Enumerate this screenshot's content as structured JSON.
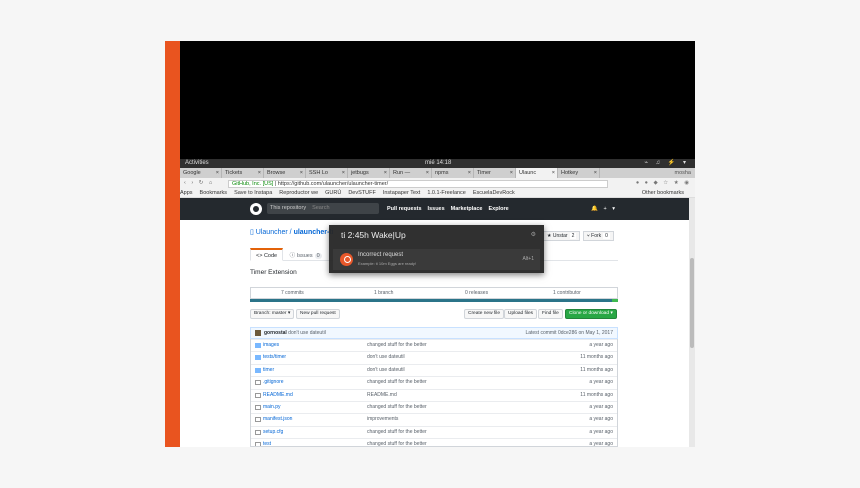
{
  "topbar": {
    "activities": "Activities",
    "clock": "mié 14:18",
    "tray": "⌁ ♫ ⚡ ▾"
  },
  "browser": {
    "tabs": [
      {
        "label": "Google",
        "active": false
      },
      {
        "label": "Tickets",
        "active": false
      },
      {
        "label": "Browse",
        "active": false
      },
      {
        "label": "SSH Lo",
        "active": false
      },
      {
        "label": "jetbugs",
        "active": false
      },
      {
        "label": "Run —",
        "active": false
      },
      {
        "label": "npms",
        "active": false
      },
      {
        "label": "Timer",
        "active": false
      },
      {
        "label": "Ulaunc",
        "active": true
      },
      {
        "label": "Hotkey",
        "active": false
      }
    ],
    "tab_close": "×",
    "window_user": "mosha",
    "nav_icons": "‹ › ↻ ⌂",
    "url_secure": "GitHub, Inc. [US]",
    "url": "https://github.com/ulauncher/ulauncher-timer/",
    "extension_icons": "● ● ◆ ☆ ★ ◉",
    "bookmarks": [
      "Apps",
      "Bookmarks",
      "Save to Instapa",
      "Reproductor we",
      "GURÚ",
      "DevSTUFF",
      "Instapaper Text",
      "1.0.1-Freelance",
      "EscuelaDevRock"
    ],
    "other_bookmarks": "Other bookmarks"
  },
  "github": {
    "search_label": "This repository",
    "search_placeholder": "Search",
    "nav": [
      "Pull requests",
      "Issues",
      "Marketplace",
      "Explore"
    ],
    "header_icons": "🔔 + ▾",
    "repo_owner": "Ulauncher",
    "repo_sep": " / ",
    "repo_name": "ulauncher-ti",
    "unstar_label": "★ Unstar",
    "unstar_count": "2",
    "fork_label": "⑂ Fork",
    "fork_count": "0",
    "tab_code": "<> Code",
    "tab_issues": "ⓘ Issues",
    "issues_count": "0",
    "description": "Timer Extension",
    "stats": {
      "commits": "7 commits",
      "branch": "1 branch",
      "releases": "0 releases",
      "contributor": "1 contributor"
    },
    "branch_btn": "Branch: master ▾",
    "new_pr_btn": "New pull request",
    "create_file_btn": "Create new file",
    "upload_btn": "Upload files",
    "find_btn": "Find file",
    "clone_btn": "Clone or download ▾",
    "commit_author": "gornostal",
    "commit_msg": "don't use dateutil",
    "latest_commit": "Latest commit 0dce286 on May 1, 2017",
    "files": [
      {
        "name": "images",
        "type": "dir",
        "message": "changed stuff for the better",
        "age": "a year ago"
      },
      {
        "name": "tests/timer",
        "type": "dir",
        "message": "don't use dateutil",
        "age": "11 months ago"
      },
      {
        "name": "timer",
        "type": "dir",
        "message": "don't use dateutil",
        "age": "11 months ago"
      },
      {
        "name": ".gitignore",
        "type": "file",
        "message": "changed stuff for the better",
        "age": "a year ago"
      },
      {
        "name": "README.md",
        "type": "file",
        "message": "README.md",
        "age": "11 months ago"
      },
      {
        "name": "main.py",
        "type": "file",
        "message": "changed stuff for the better",
        "age": "a year ago"
      },
      {
        "name": "manifest.json",
        "type": "file",
        "message": "improvements",
        "age": "a year ago"
      },
      {
        "name": "setup.cfg",
        "type": "file",
        "message": "changed stuff for the better",
        "age": "a year ago"
      },
      {
        "name": "test",
        "type": "file",
        "message": "changed stuff for the better",
        "age": "a year ago"
      }
    ]
  },
  "ulauncher": {
    "query": "ti 2:45h Wake|Up",
    "gear_icon": "⚙",
    "result_title": "Incorrect request",
    "result_subtitle": "Example: ti 10m Eggs are ready!",
    "result_shortcut": "Alt+1"
  }
}
